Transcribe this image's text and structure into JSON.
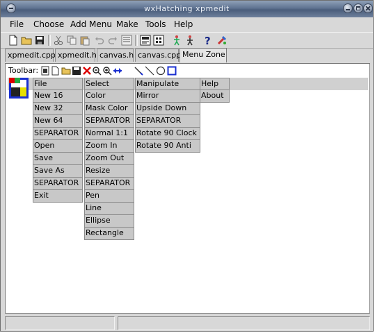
{
  "window": {
    "title": "wxHatching xpmedit"
  },
  "menubar": [
    {
      "label": "File"
    },
    {
      "label": "Choose"
    },
    {
      "label": "Add Menu"
    },
    {
      "label": "Make"
    },
    {
      "label": "Tools"
    },
    {
      "label": "Help"
    }
  ],
  "toolbar_icons": [
    "new-file-icon",
    "open-folder-icon",
    "save-icon",
    "cut-icon",
    "copy-icon",
    "paste-icon",
    "undo-icon",
    "redo-icon",
    "find-icon",
    "build-icon",
    "grid-icon",
    "run-icon",
    "debug-icon",
    "help-icon",
    "tools-icon"
  ],
  "tabs": [
    {
      "label": "xpmedit.cpp"
    },
    {
      "label": "xpmedit.h"
    },
    {
      "label": "canvas.h"
    },
    {
      "label": "canvas.cpp"
    },
    {
      "label": "Menu Zone",
      "active": true
    }
  ],
  "panel": {
    "toolbar_label": "Toolbar:",
    "columns": [
      {
        "items": [
          "File",
          "New 16",
          "New 32",
          "New 64",
          "SEPARATOR",
          "Open",
          "Save",
          "Save As",
          "SEPARATOR",
          "Exit"
        ]
      },
      {
        "items": [
          "Select",
          "Color",
          "Mask Color",
          "SEPARATOR",
          "Normal 1:1",
          "Zoom In",
          "Zoom Out",
          "Resize",
          "SEPARATOR",
          "Pen",
          "Line",
          "Ellipse",
          "Rectangle"
        ]
      },
      {
        "items": [
          "Manipulate",
          "Mirror",
          "Upside Down",
          "SEPARATOR",
          "Rotate 90 Clock",
          "Rotate 90 Anti"
        ]
      },
      {
        "items": [
          "Help",
          "About"
        ]
      }
    ]
  },
  "colors": {
    "title_bar": "#5f7391",
    "panel_bg": "#ffffff",
    "cell_bg": "#c8c8c8"
  }
}
